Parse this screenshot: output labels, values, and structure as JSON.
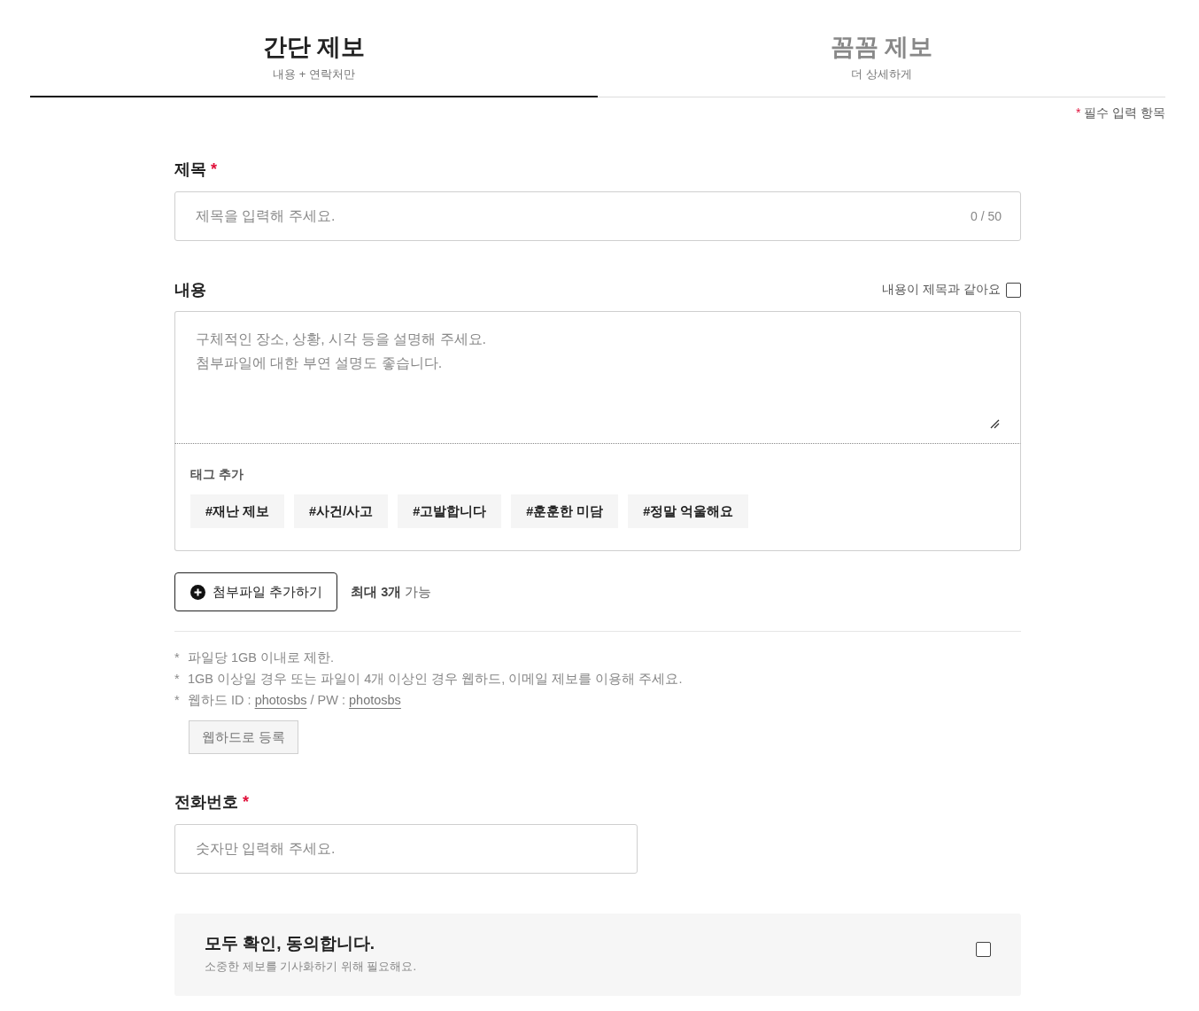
{
  "tabs": [
    {
      "title": "간단 제보",
      "subtitle": "내용 + 연락처만",
      "selected": true
    },
    {
      "title": "꼼꼼 제보",
      "subtitle": "더 상세하게",
      "selected": false
    }
  ],
  "required_note": {
    "mark": "*",
    "text": "필수 입력 항목"
  },
  "title_field": {
    "label": "제목",
    "required_mark": "*",
    "placeholder": "제목을 입력해 주세요.",
    "counter": "0 / 50"
  },
  "content_field": {
    "label": "내용",
    "same_as_title": {
      "label": "내용이 제목과 같아요",
      "checked": false
    },
    "placeholder": "구체적인 장소, 상황, 시각 등을 설명해 주세요.\n첨부파일에 대한 부연 설명도 좋습니다.",
    "tags_label": "태그 추가",
    "tags": [
      "#재난 제보",
      "#사건/사고",
      "#고발합니다",
      "#훈훈한 미담",
      "#정말 억울해요"
    ]
  },
  "attachment": {
    "button": "첨부파일 추가하기",
    "note": "**최대 3개** 가능"
  },
  "notes": [
    {
      "mark": "*",
      "segments": [
        {
          "kind": "text",
          "text": "파일당 1GB 이내로 제한."
        }
      ]
    },
    {
      "mark": "*",
      "segments": [
        {
          "kind": "text",
          "text": "1GB 이상일 경우 또는 파일이 4개 이상인 경우 웹하드, 이메일 제보를 이용해 주세요."
        }
      ]
    },
    {
      "mark": "*",
      "segments": [
        {
          "kind": "text",
          "text": "웹하드 ID : "
        },
        {
          "kind": "link",
          "text": "photosbs"
        },
        {
          "kind": "text",
          "text": " / PW : "
        },
        {
          "kind": "link",
          "text": "photosbs"
        }
      ]
    }
  ],
  "webhard_button": "웹하드로 등록",
  "phone_field": {
    "label": "전화번호",
    "required_mark": "*",
    "placeholder": "숫자만 입력해 주세요."
  },
  "agreement": {
    "title": "모두 확인, 동의합니다.",
    "subtitle": "소중한 제보를 기사화하기 위해 필요해요.",
    "checked": false
  }
}
